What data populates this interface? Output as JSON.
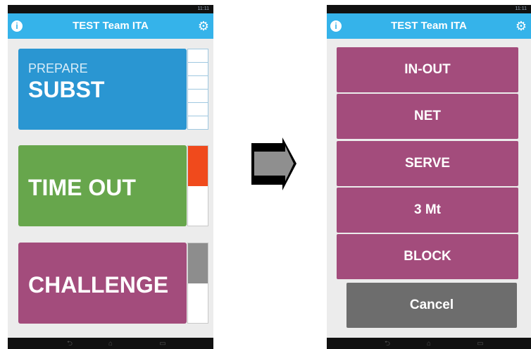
{
  "left_screen": {
    "status": "11:11",
    "title": "TEST Team ITA",
    "subst_tile": {
      "small": "PREPARE",
      "big": "SUBST"
    },
    "timeout_tile": {
      "big": "TIME OUT"
    },
    "challenge_tile": {
      "big": "CHALLENGE"
    },
    "counters": {
      "subst_cells": 6,
      "timeout_filled_fraction": 0.5,
      "challenge_filled_fraction": 0.5
    }
  },
  "right_screen": {
    "status": "11:11",
    "title": "TEST Team ITA",
    "options": [
      "IN-OUT",
      "NET",
      "SERVE",
      "3 Mt",
      "BLOCK"
    ],
    "cancel": "Cancel"
  },
  "colors": {
    "titlebar": "#35b3ea",
    "subst": "#2a96d2",
    "timeout": "#67a64c",
    "challenge": "#a34c7c",
    "cancel": "#6d6d6d",
    "timeout_indicator": "#f04a1c",
    "challenge_indicator": "#8d8d8d"
  }
}
